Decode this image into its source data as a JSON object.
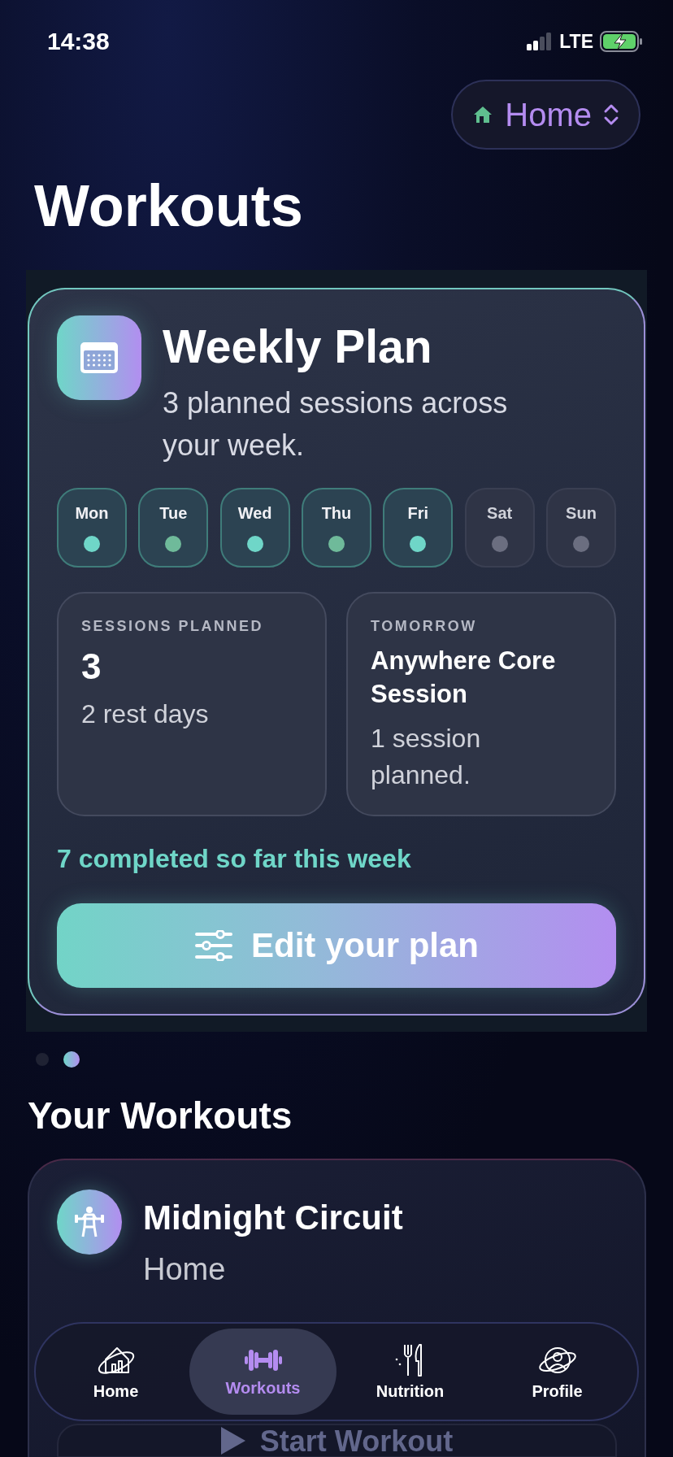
{
  "status_bar": {
    "time": "14:38",
    "network": "LTE"
  },
  "location_picker": {
    "label": "Home"
  },
  "title": "Workouts",
  "weekly_plan": {
    "title": "Weekly Plan",
    "subtitle": "3 planned sessions across your week.",
    "days": [
      {
        "label": "Mon",
        "planned": true,
        "color": "#6fd6c8"
      },
      {
        "label": "Tue",
        "planned": true,
        "color": "#6fba9a"
      },
      {
        "label": "Wed",
        "planned": true,
        "color": "#6fd6c8"
      },
      {
        "label": "Thu",
        "planned": true,
        "color": "#6fba9a"
      },
      {
        "label": "Fri",
        "planned": true,
        "color": "#6fd6c8"
      },
      {
        "label": "Sat",
        "planned": false,
        "color": "#6b6e80"
      },
      {
        "label": "Sun",
        "planned": false,
        "color": "#6b6e80"
      }
    ],
    "stats": [
      {
        "label": "SESSIONS PLANNED",
        "value": "3",
        "detail": "2 rest days"
      },
      {
        "label": "TOMORROW",
        "value": "Anywhere Core Session",
        "detail": "1 session planned."
      }
    ],
    "completed": "7 completed so far this week",
    "button": "Edit your plan"
  },
  "page_dots": [
    {
      "selected": false
    },
    {
      "selected": true
    }
  ],
  "section_title": "Your Workouts",
  "workout": {
    "title": "Midnight Circuit",
    "location": "Home",
    "button": "Start Workout"
  },
  "tab_bar": [
    {
      "label": "Home",
      "selected": false
    },
    {
      "label": "Workouts",
      "selected": true
    },
    {
      "label": "Nutrition",
      "selected": false
    },
    {
      "label": "Profile",
      "selected": false
    }
  ]
}
